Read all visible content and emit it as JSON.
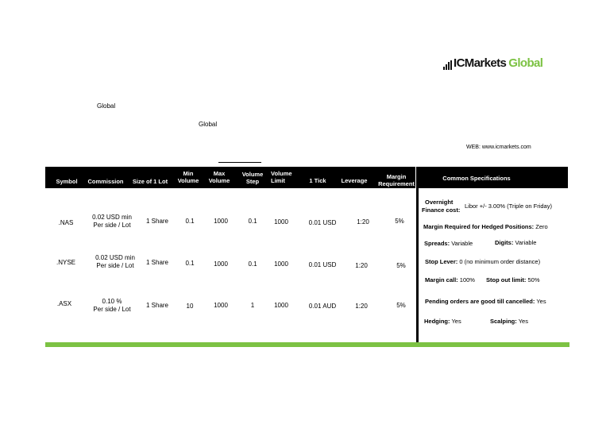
{
  "logo": {
    "ic": "ICMarkets",
    "global": "Global"
  },
  "labels": {
    "global1": "Global",
    "global2": "Global",
    "web": "WEB: www.icmarkets.com"
  },
  "header": {
    "symbol": "Symbol",
    "commission": "Commission",
    "size": "Size of 1 Lot",
    "min_volume": [
      "Min",
      "Volume"
    ],
    "max_volume": [
      "Max",
      "Volume"
    ],
    "volume_step": [
      "Volume",
      "Step"
    ],
    "volume_limit": [
      "Volume",
      "Limit"
    ],
    "tick": "1 Tick",
    "leverage": "Leverage",
    "margin": [
      "Margin",
      "Requirement"
    ],
    "common": "Common Specifications"
  },
  "rows": [
    {
      "symbol": ".NAS",
      "commission": [
        "0.02 USD min",
        "Per side / Lot"
      ],
      "size": "1 Share",
      "min": "0.1",
      "max": "1000",
      "step": "0.1",
      "limit": "1000",
      "tick": "0.01 USD",
      "leverage": "1:20",
      "margin": "5%"
    },
    {
      "symbol": ".NYSE",
      "commission": [
        "0.02 USD min",
        "Per side / Lot"
      ],
      "size": "1 Share",
      "min": "0.1",
      "max": "1000",
      "step": "0.1",
      "limit": "1000",
      "tick": "0.01 USD",
      "leverage": "1:20",
      "margin": "5%"
    },
    {
      "symbol": ".ASX",
      "commission": [
        "0.10 %",
        "Per side / Lot"
      ],
      "size": "1 Share",
      "min": "10",
      "max": "1000",
      "step": "1",
      "limit": "1000",
      "tick": "0.01 AUD",
      "leverage": "1:20",
      "margin": "5%"
    }
  ],
  "specs": {
    "overnight_label": [
      "Overnight",
      "Finance cost:"
    ],
    "overnight_value": "Libor +/- 3.00% (Triple on Friday)",
    "hedged_label": "Margin Required for Hedged Positions:",
    "hedged_value": "Zero",
    "spreads_label": "Spreads:",
    "spreads_value": "Variable",
    "digits_label": "Digits:",
    "digits_value": "Variable",
    "stop_label": "Stop Lever:",
    "stop_value": "0 (no minimum order distance)",
    "margin_call_label": "Margin call:",
    "margin_call_value": "100%",
    "stop_out_label": "Stop out limit:",
    "stop_out_value": "50%",
    "pending_label": "Pending orders are good till cancelled:",
    "pending_value": "Yes",
    "hedging_label": "Hedging:",
    "hedging_value": "Yes",
    "scalping_label": "Scalping:",
    "scalping_value": "Yes"
  },
  "colors": {
    "accent": "#7cc243",
    "header_bg": "#000000"
  }
}
